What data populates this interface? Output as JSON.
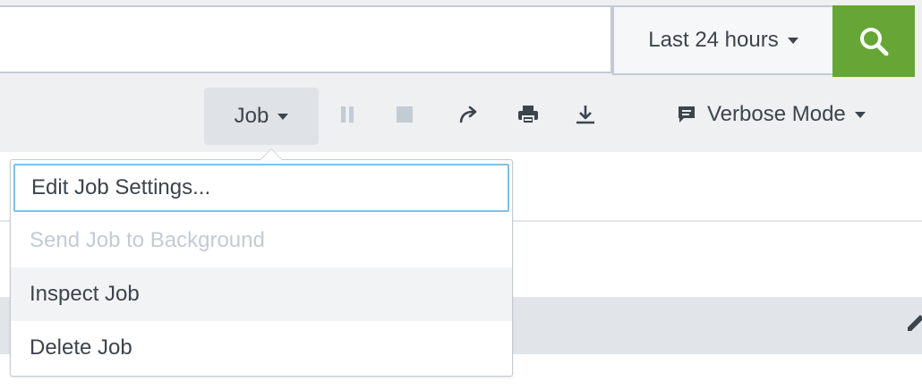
{
  "search": {
    "time_range": "Last 24 hours",
    "search_button_icon": "search-icon"
  },
  "toolbar": {
    "job_label": "Job",
    "pause_icon": "pause-icon",
    "stop_icon": "stop-icon",
    "share_icon": "share-icon",
    "print_icon": "print-icon",
    "export_icon": "download-icon",
    "mode_icon": "comment-icon",
    "mode_label": "Verbose Mode"
  },
  "job_menu": {
    "items": [
      {
        "label": "Edit Job Settings...",
        "state": "focused"
      },
      {
        "label": "Send Job to Background",
        "state": "disabled"
      },
      {
        "label": "Inspect Job",
        "state": "hover"
      },
      {
        "label": "Delete Job",
        "state": "normal"
      }
    ]
  },
  "colors": {
    "accent_green": "#65a637",
    "focus_blue": "#7fc0ea",
    "toolbar_bg": "#eef0f2"
  }
}
